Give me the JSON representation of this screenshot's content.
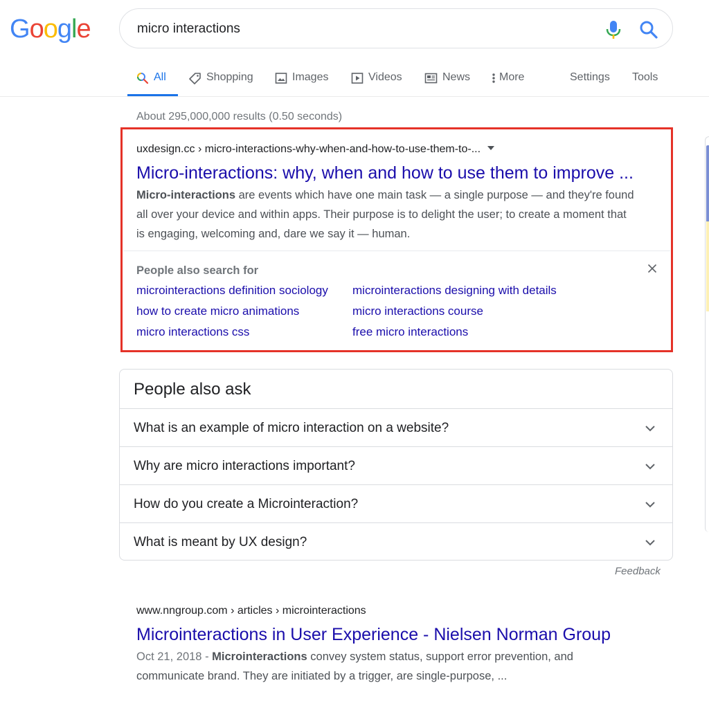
{
  "logo": {
    "letters": [
      "G",
      "o",
      "o",
      "g",
      "l",
      "e"
    ],
    "colors": [
      "#4285f4",
      "#ea4335",
      "#fbbc05",
      "#4285f4",
      "#34a853",
      "#ea4335"
    ]
  },
  "search": {
    "query": "micro interactions",
    "mic_icon": "microphone-icon",
    "search_icon": "search-icon"
  },
  "tabs": [
    {
      "label": "All",
      "icon": "search-icon",
      "active": true
    },
    {
      "label": "Shopping",
      "icon": "tag-icon",
      "active": false
    },
    {
      "label": "Images",
      "icon": "image-icon",
      "active": false
    },
    {
      "label": "Videos",
      "icon": "play-icon",
      "active": false
    },
    {
      "label": "News",
      "icon": "newspaper-icon",
      "active": false
    },
    {
      "label": "More",
      "icon": "more-vert-icon",
      "active": false
    }
  ],
  "tools": {
    "settings": "Settings",
    "tools": "Tools"
  },
  "result_stats": "About 295,000,000 results (0.50 seconds)",
  "result1": {
    "cite": "uxdesign.cc › micro-interactions-why-when-and-how-to-use-them-to-...",
    "title": "Micro-interactions: why, when and how to use them to improve ...",
    "snippet_bold": "Micro-interactions",
    "snippet_line1_rest": " are events which have one main task — a single purpose — and they're found",
    "snippet_line2": "all over your device and within apps. Their purpose is to delight the user; to create a moment that",
    "snippet_line3": "is engaging, welcoming and, dare we say it — human.",
    "highlight_color": "#e53228"
  },
  "people_also_search": {
    "title": "People also search for",
    "links": [
      "microinteractions definition sociology",
      "microinteractions designing with details",
      "how to create micro animations",
      "micro interactions course",
      "micro interactions css",
      "free micro interactions"
    ]
  },
  "people_also_ask": {
    "heading": "People also ask",
    "questions": [
      "What is an example of micro interaction on a website?",
      "Why are micro interactions important?",
      "How do you create a Microinteraction?",
      "What is meant by UX design?"
    ],
    "feedback": "Feedback"
  },
  "result2": {
    "cite": "www.nngroup.com › articles › microinteractions",
    "title": "Microinteractions in User Experience - Nielsen Norman Group",
    "date": "Oct 21, 2018 - ",
    "snippet_bold": "Microinteractions",
    "snippet_line1_rest": " convey system status, support error prevention, and",
    "snippet_line2": "communicate brand. They are initiated by a trigger, are single-purpose, ..."
  },
  "colors": {
    "link": "#1a0dab",
    "accent": "#1a73e8",
    "muted": "#70757a"
  }
}
